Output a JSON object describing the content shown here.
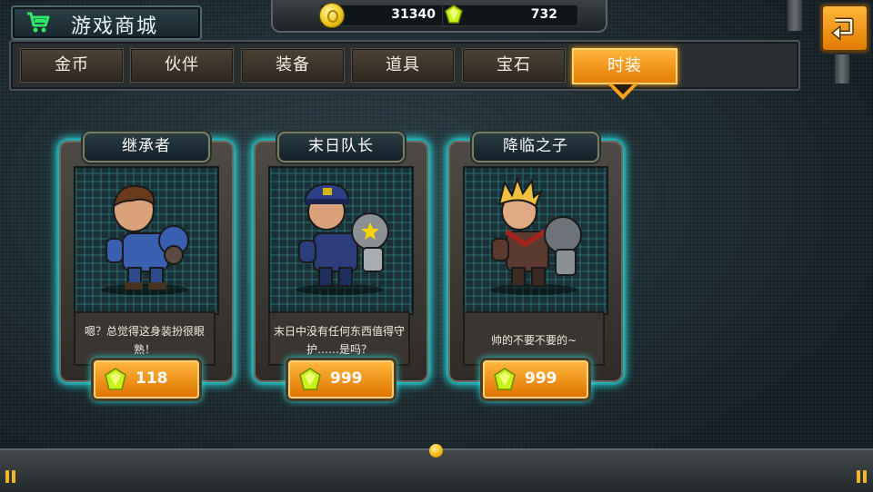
{
  "header": {
    "title": "游戏商城",
    "currency": {
      "coins": "31340",
      "gems": "732"
    }
  },
  "tabs": [
    {
      "label": "金币",
      "active": false
    },
    {
      "label": "伙伴",
      "active": false
    },
    {
      "label": "装备",
      "active": false
    },
    {
      "label": "道具",
      "active": false
    },
    {
      "label": "宝石",
      "active": false
    },
    {
      "label": "时装",
      "active": true
    }
  ],
  "items": [
    {
      "name": "继承者",
      "desc": "嗯？总觉得这身装扮很眼熟！",
      "price": "118",
      "outfit_color": "#3a5fb0"
    },
    {
      "name": "末日队长",
      "desc": "末日中没有任何东西值得守护……是吗？",
      "price": "999",
      "outfit_color": "#2b3d7a"
    },
    {
      "name": "降临之子",
      "desc": "帅的不要不要的~",
      "price": "999",
      "outfit_color": "#5a3a2e"
    }
  ],
  "colors": {
    "accent": "#ffa41a",
    "glow": "#28e3e6"
  }
}
